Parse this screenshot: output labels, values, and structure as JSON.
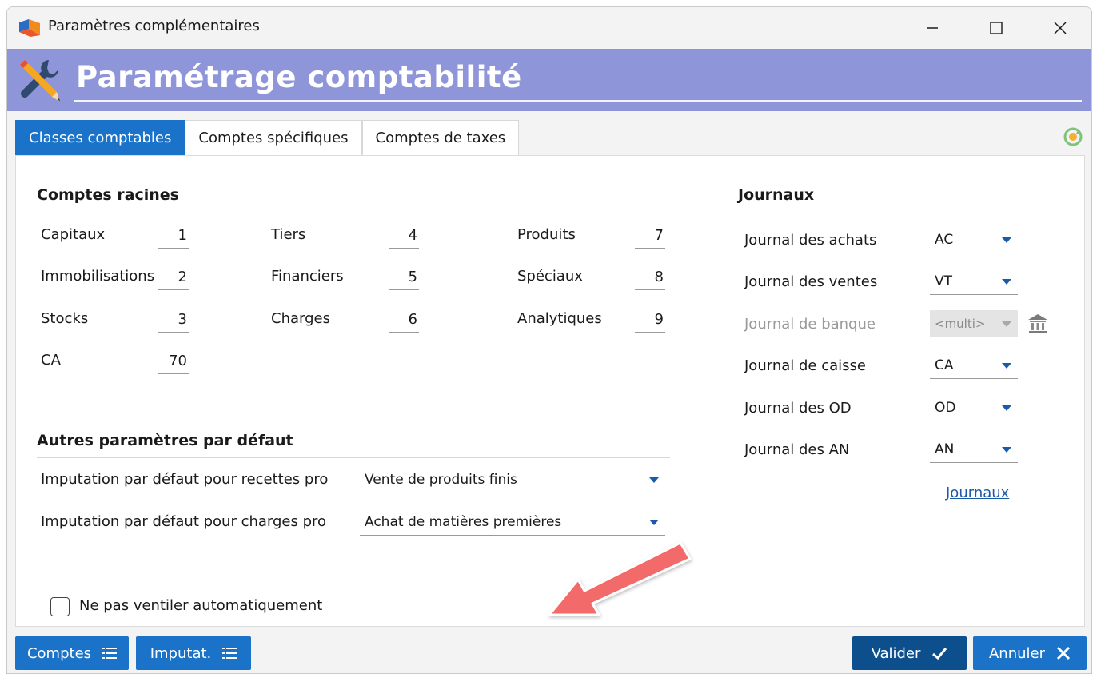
{
  "window": {
    "title": "Paramètres complémentaires"
  },
  "header": {
    "title": "Paramétrage comptabilité"
  },
  "tabs": [
    {
      "label": "Classes comptables",
      "active": true
    },
    {
      "label": "Comptes spécifiques",
      "active": false
    },
    {
      "label": "Comptes de taxes",
      "active": false
    }
  ],
  "comptes_racines": {
    "title": "Comptes racines",
    "fields": [
      {
        "label": "Capitaux",
        "value": "1"
      },
      {
        "label": "Immobilisations",
        "value": "2"
      },
      {
        "label": "Stocks",
        "value": "3"
      },
      {
        "label": "CA",
        "value": "70"
      },
      {
        "label": "Tiers",
        "value": "4"
      },
      {
        "label": "Financiers",
        "value": "5"
      },
      {
        "label": "Charges",
        "value": "6"
      },
      {
        "label": "Produits",
        "value": "7"
      },
      {
        "label": "Spéciaux",
        "value": "8"
      },
      {
        "label": "Analytiques",
        "value": "9"
      }
    ]
  },
  "autres": {
    "title": "Autres paramètres par défaut",
    "recettes_label": "Imputation par défaut pour recettes pro",
    "recettes_value": "Vente de produits finis",
    "charges_label": "Imputation par défaut pour charges pro",
    "charges_value": "Achat de matières premières"
  },
  "checkbox": {
    "label": "Ne pas ventiler automatiquement",
    "checked": false
  },
  "journaux": {
    "title": "Journaux",
    "items": [
      {
        "label": "Journal des achats",
        "value": "AC",
        "disabled": false
      },
      {
        "label": "Journal des ventes",
        "value": "VT",
        "disabled": false
      },
      {
        "label": "Journal de banque",
        "value": "<multi>",
        "disabled": true
      },
      {
        "label": "Journal de caisse",
        "value": "CA",
        "disabled": false
      },
      {
        "label": "Journal des OD",
        "value": "OD",
        "disabled": false
      },
      {
        "label": "Journal des AN",
        "value": "AN",
        "disabled": false
      }
    ],
    "link": "Journaux"
  },
  "buttons": {
    "comptes": "Comptes",
    "imputat": "Imputat.",
    "valider": "Valider",
    "annuler": "Annuler"
  },
  "colors": {
    "header": "#8f95d9",
    "accent": "#1a73c8",
    "dark_accent": "#0d4f8c",
    "arrow": "#f26b6b"
  }
}
